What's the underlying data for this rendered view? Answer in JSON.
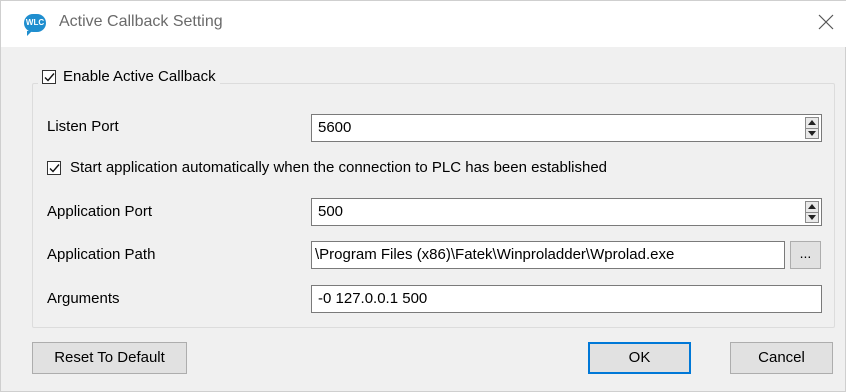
{
  "window": {
    "title": "Active Callback Setting",
    "icon_text": "WLC",
    "icon_color": "#1f8ecf"
  },
  "group": {
    "enable_label": "Enable Active Callback",
    "enable_checked": true
  },
  "listen_port": {
    "label": "Listen Port",
    "value": "5600"
  },
  "auto_start": {
    "label": "Start application automatically when the connection to PLC has been established",
    "checked": true
  },
  "app_port": {
    "label": "Application Port",
    "value": "500"
  },
  "app_path": {
    "label": "Application Path",
    "value": "\\Program Files (x86)\\Fatek\\Winproladder\\Wprolad.exe",
    "browse_label": "..."
  },
  "arguments": {
    "label": "Arguments",
    "value": "-0 127.0.0.1 500"
  },
  "buttons": {
    "reset": "Reset To Default",
    "ok": "OK",
    "cancel": "Cancel"
  }
}
